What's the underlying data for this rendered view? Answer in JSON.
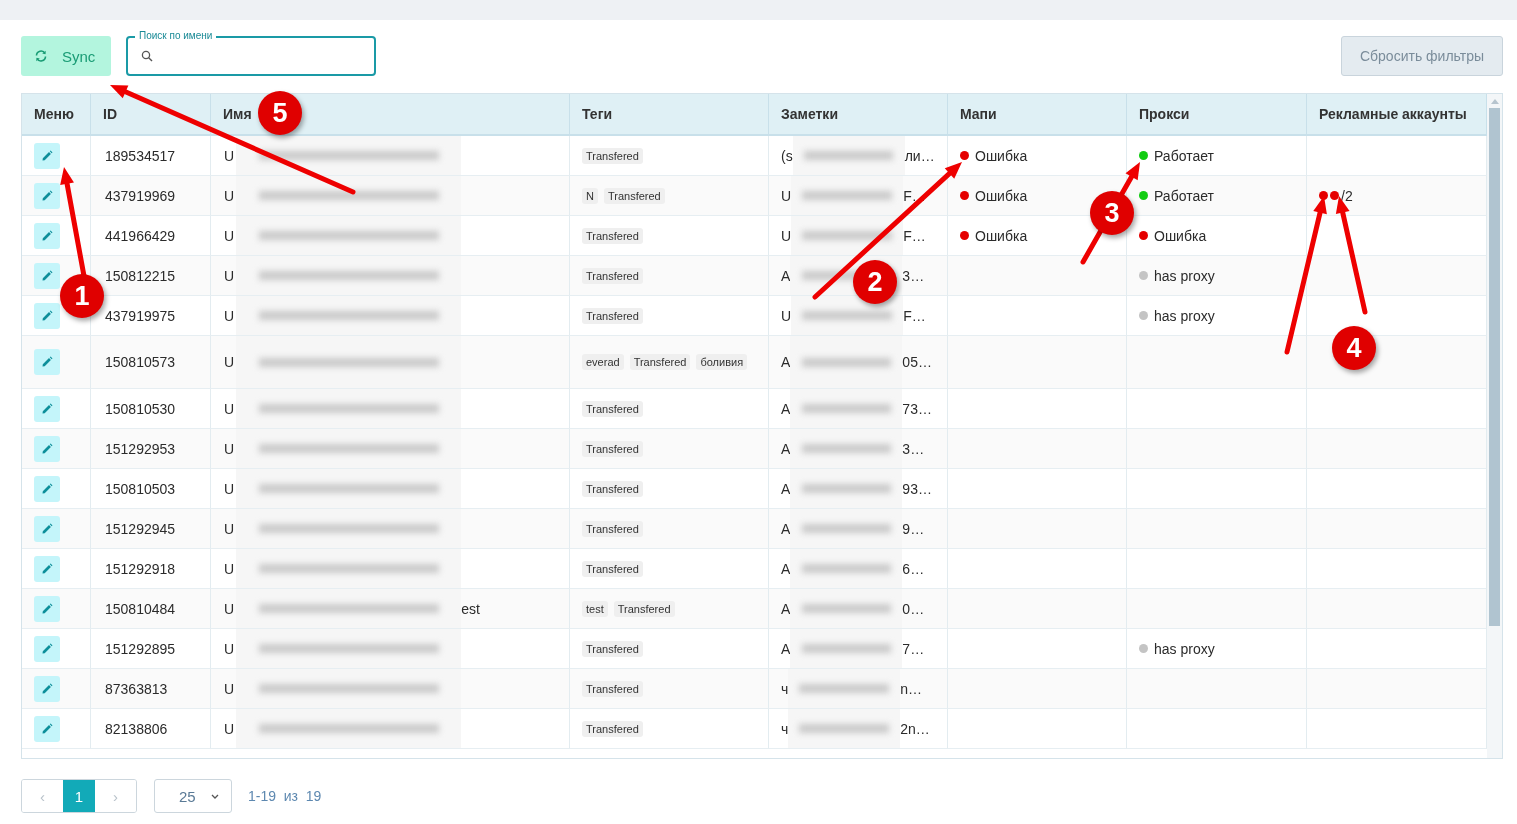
{
  "toolbar": {
    "sync_button": "Sync",
    "search_label": "Поиск по имени",
    "reset_button": "Сбросить фильтры"
  },
  "table": {
    "columns": [
      "Меню",
      "ID",
      "Имя",
      "Теги",
      "Заметки",
      "Мапи",
      "Прокси",
      "Рекламные аккаунты"
    ],
    "rows": [
      {
        "id": "189534517",
        "name_start": "U",
        "tags": [
          "Transfered"
        ],
        "notes_start": "(s",
        "notes_end": "ли…",
        "mapi": {
          "text": "Ошибка",
          "color": "#e50000"
        },
        "proxy": {
          "text": "Работает",
          "color": "#11cc11"
        }
      },
      {
        "id": "437919969",
        "name_start": "U",
        "tags": [
          "N",
          "Transfered"
        ],
        "notes_start": "U",
        "notes_end": "F…",
        "mapi": {
          "text": "Ошибка",
          "color": "#e50000"
        },
        "proxy": {
          "text": "Работает",
          "color": "#11cc11"
        },
        "ads": {
          "dots": [
            {
              "color": "#e50000"
            },
            {
              "color": "#e50000"
            }
          ],
          "text": "/2"
        }
      },
      {
        "id": "441966429",
        "name_start": "U",
        "tags": [
          "Transfered"
        ],
        "notes_start": "U",
        "notes_end": "F…",
        "mapi": {
          "text": "Ошибка",
          "color": "#e50000"
        },
        "proxy": {
          "text": "Ошибка",
          "color": "#e50000"
        }
      },
      {
        "id": "150812215",
        "name_start": "U",
        "tags": [
          "Transfered"
        ],
        "notes_start": "A",
        "notes_end": "3…",
        "proxy": {
          "text": "has proxy",
          "color": "#c4c4c4"
        }
      },
      {
        "id": "437919975",
        "name_start": "U",
        "tags": [
          "Transfered"
        ],
        "notes_start": "U",
        "notes_end": "F…",
        "proxy": {
          "text": "has proxy",
          "color": "#c4c4c4"
        }
      },
      {
        "id": "150810573",
        "name_start": "U",
        "tags": [
          "everad",
          "Transfered",
          "боливия"
        ],
        "notes_start": "A",
        "notes_end": "05…"
      },
      {
        "id": "150810530",
        "name_start": "U",
        "tags": [
          "Transfered"
        ],
        "notes_start": "A",
        "notes_end": "73…"
      },
      {
        "id": "151292953",
        "name_start": "U",
        "tags": [
          "Transfered"
        ],
        "notes_start": "A",
        "notes_end": "3…"
      },
      {
        "id": "150810503",
        "name_start": "U",
        "tags": [
          "Transfered"
        ],
        "notes_start": "A",
        "notes_end": "93…"
      },
      {
        "id": "151292945",
        "name_start": "U",
        "tags": [
          "Transfered"
        ],
        "notes_start": "A",
        "notes_end": "9…"
      },
      {
        "id": "151292918",
        "name_start": "U",
        "tags": [
          "Transfered"
        ],
        "notes_start": "A",
        "notes_end": "6…"
      },
      {
        "id": "150810484",
        "name_start": "U",
        "name_end": "est",
        "tags": [
          "test",
          "Transfered"
        ],
        "notes_start": "A",
        "notes_end": "0…"
      },
      {
        "id": "151292895",
        "name_start": "U",
        "tags": [
          "Transfered"
        ],
        "notes_start": "A",
        "notes_end": "7…",
        "proxy": {
          "text": "has proxy",
          "color": "#c4c4c4"
        }
      },
      {
        "id": "87363813",
        "name_start": "U",
        "tags": [
          "Transfered"
        ],
        "notes_start": "ч",
        "notes_end": "n…"
      },
      {
        "id": "82138806",
        "name_start": "U",
        "tags": [
          "Transfered"
        ],
        "notes_start": "ч",
        "notes_end": "2n…"
      }
    ]
  },
  "pagination": {
    "prev": "‹",
    "pages": [
      {
        "label": "1",
        "selected": true
      }
    ],
    "next": "›",
    "page_size": "25",
    "summary": "1-19  из  19"
  },
  "annotations": [
    {
      "label": "1"
    },
    {
      "label": "2"
    },
    {
      "label": "3"
    },
    {
      "label": "4"
    },
    {
      "label": "5"
    }
  ]
}
